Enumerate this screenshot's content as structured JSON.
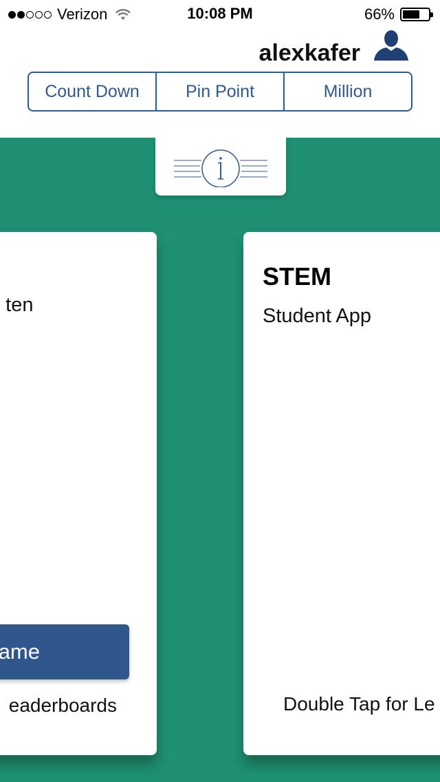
{
  "status_bar": {
    "carrier": "Verizon",
    "signal_bars_filled": 2,
    "signal_bars_total": 5,
    "time": "10:08 PM",
    "battery_text": "66%",
    "battery_level": 0.66
  },
  "header": {
    "username": "alexkafer",
    "tabs": [
      {
        "label": "Count Down"
      },
      {
        "label": "Pin Point"
      },
      {
        "label": "Million"
      }
    ]
  },
  "cards": [
    {
      "subtitle": "p ten",
      "button_label": "ame",
      "footer": "eaderboards"
    },
    {
      "title": "STEM",
      "subtitle": "Student App",
      "footer": "Double Tap for Le"
    }
  ],
  "colors": {
    "background_green": "#1f9072",
    "accent_blue": "#2d5a8f",
    "button_blue": "#2f578c"
  },
  "icons": {
    "user": "user-icon",
    "info": "info-icon",
    "wifi": "wifi-icon",
    "battery": "battery-icon"
  }
}
